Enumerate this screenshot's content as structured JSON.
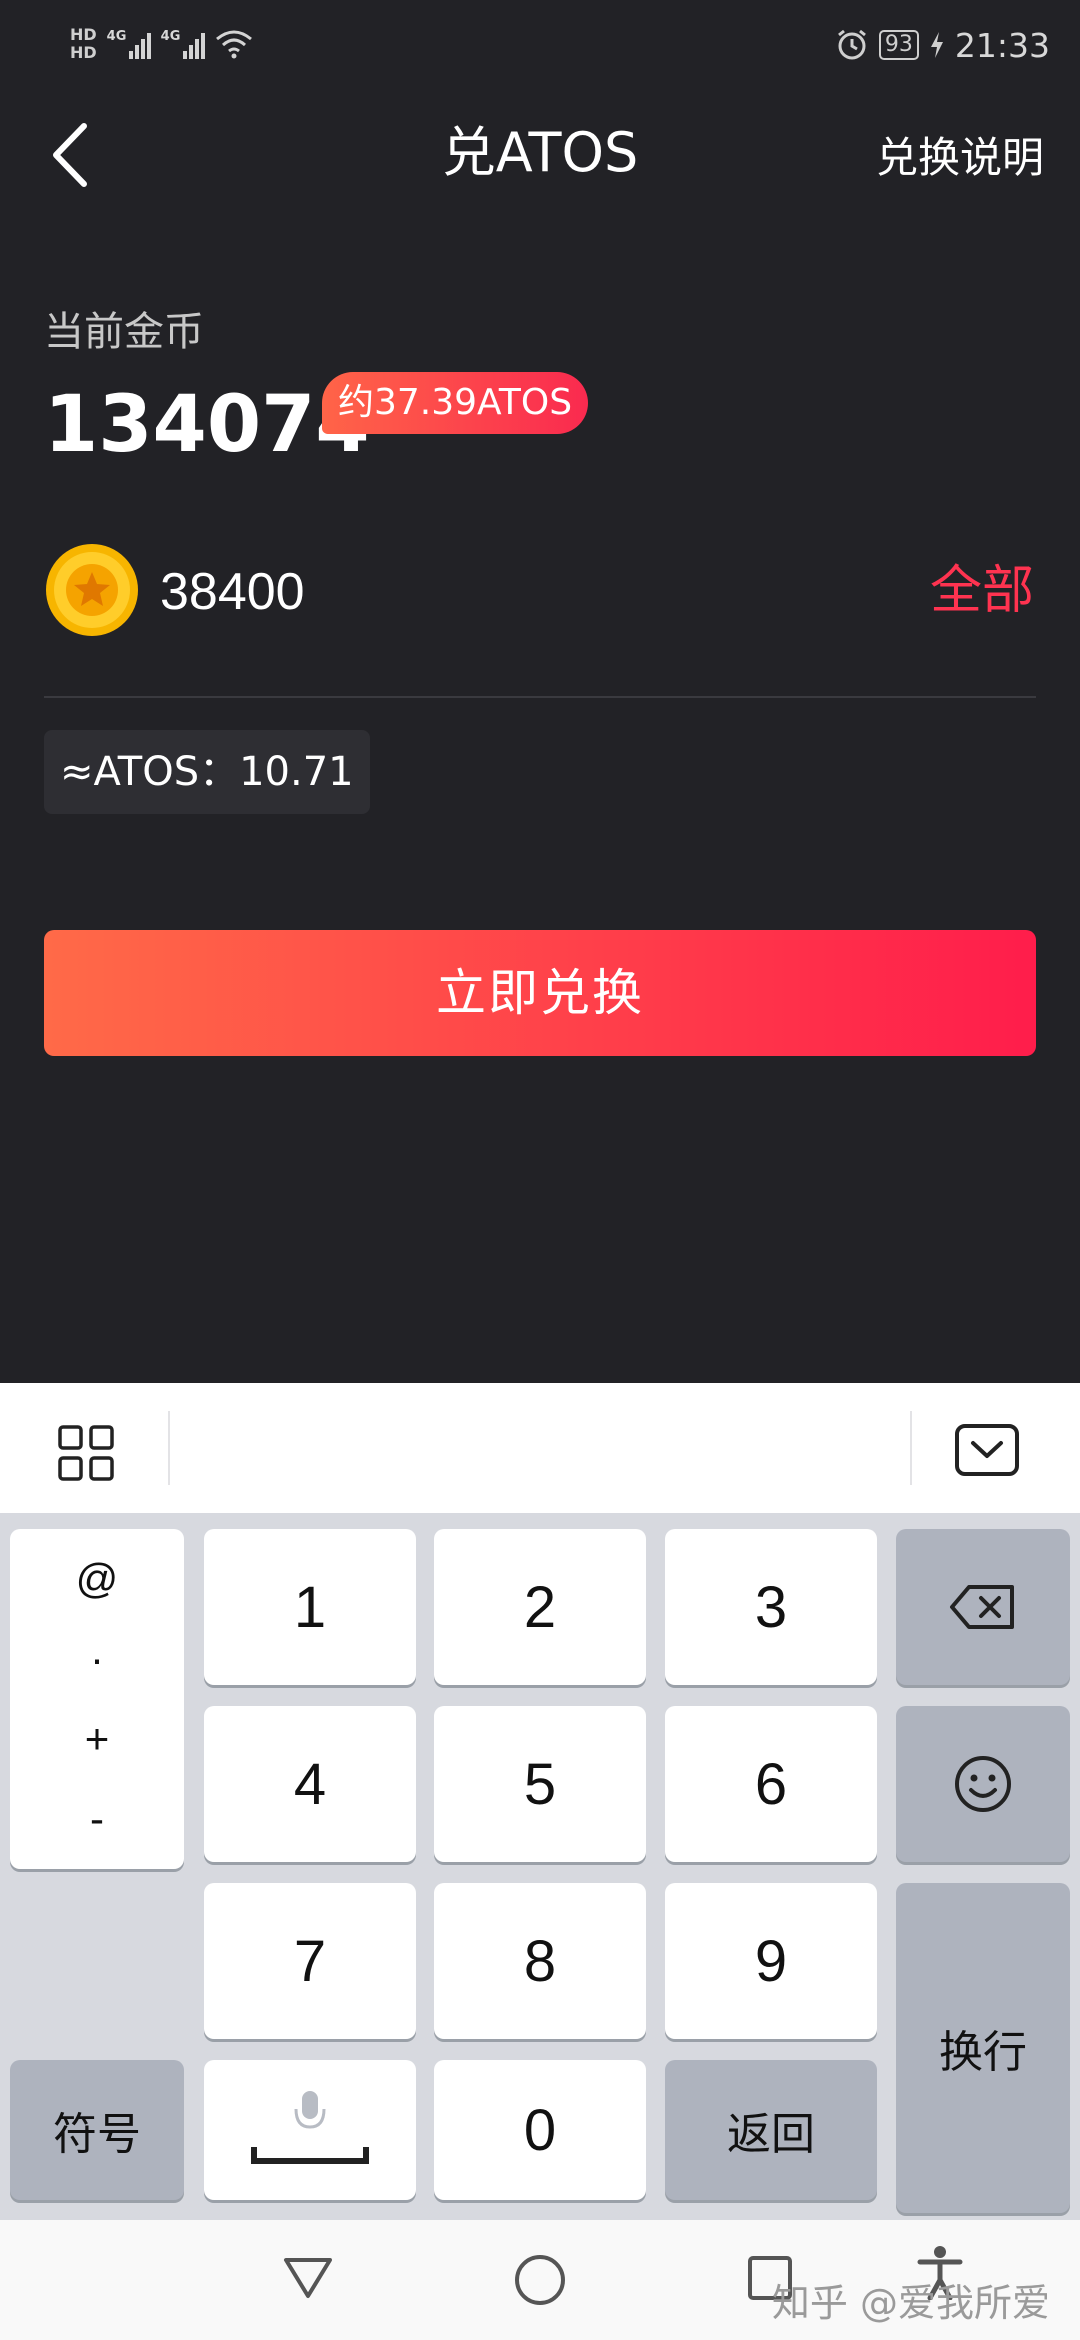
{
  "status_bar": {
    "hd1": "HD",
    "hd2": "HD",
    "net1": "4G",
    "net2": "4G",
    "battery": "93",
    "time": "21:33"
  },
  "header": {
    "title": "兑ATOS",
    "help_link": "兑换说明"
  },
  "balance": {
    "label": "当前金币",
    "value": "134074",
    "approx": "约37.39ATOS"
  },
  "input": {
    "value": "38400",
    "all_label": "全部"
  },
  "result": {
    "text": "≈ATOS：10.71"
  },
  "action": {
    "exchange_label": "立即兑换"
  },
  "keyboard": {
    "symbols": [
      "@",
      "·",
      "+",
      "-"
    ],
    "digits": [
      "1",
      "2",
      "3",
      "4",
      "5",
      "6",
      "7",
      "8",
      "9",
      "0"
    ],
    "symbol_key": "符号",
    "return_key": "返回",
    "enter_key": "换行"
  },
  "watermark": "知乎 @爱我所爱",
  "colors": {
    "background": "#222226",
    "accent_red": "#ff3350",
    "gradient_start": "#ff6a48",
    "gradient_end": "#ff1d4b",
    "keyboard_bg": "#d7d9df"
  }
}
